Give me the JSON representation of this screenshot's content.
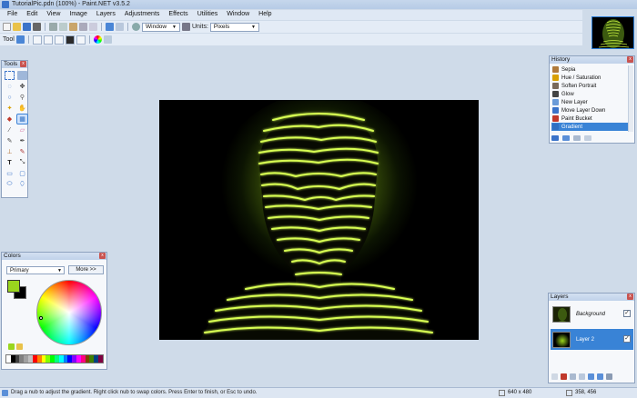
{
  "window": {
    "title": "TutorialPic.pdn (100%) - Paint.NET v3.5.2",
    "minimize": "–",
    "maximize": "□",
    "close": "✕"
  },
  "menu": [
    "File",
    "Edit",
    "View",
    "Image",
    "Layers",
    "Adjustments",
    "Effects",
    "Utilities",
    "Window",
    "Help"
  ],
  "toolbar": {
    "window_label": "Window",
    "units_label": "Units:",
    "units_value": "Pixels",
    "tool_label": "Tool"
  },
  "panels": {
    "tools_title": "Tools",
    "history_title": "History",
    "colors_title": "Colors",
    "layers_title": "Layers",
    "close_glyph": "x"
  },
  "history": {
    "items": [
      {
        "label": "Sepia",
        "color": "#b07a3a"
      },
      {
        "label": "Hue / Saturation",
        "color": "#d9a000"
      },
      {
        "label": "Soften Portrait",
        "color": "#7a6a5a"
      },
      {
        "label": "Glow",
        "color": "#444444"
      },
      {
        "label": "New Layer",
        "color": "#6b9bd8"
      },
      {
        "label": "Move Layer Down",
        "color": "#3a73c9"
      },
      {
        "label": "Paint Bucket",
        "color": "#c0392b"
      },
      {
        "label": "Gradient",
        "color": "#2d6fc2",
        "active": true
      }
    ]
  },
  "colors": {
    "mode": "Primary",
    "more_button": "More >>",
    "primary": "#9ad61e",
    "secondary": "#000000",
    "palette": [
      "#ffffff",
      "#000000",
      "#404040",
      "#808080",
      "#a0a0a0",
      "#c0c0c0",
      "#ff0000",
      "#ff8000",
      "#ffff00",
      "#80ff00",
      "#00ff00",
      "#00ff80",
      "#00ffff",
      "#0080ff",
      "#0000ff",
      "#8000ff",
      "#ff00ff",
      "#ff0080",
      "#804000",
      "#408000",
      "#004080",
      "#800040"
    ]
  },
  "layers": {
    "items": [
      {
        "name": "Background",
        "checked": "✓"
      },
      {
        "name": "Layer 2",
        "checked": "✓",
        "active": true
      }
    ]
  },
  "status": {
    "hint": "Drag a nub to adjust the gradient. Right click nub to swap colors. Press Enter to finish, or Esc to undo.",
    "image_size": "640 x 480",
    "cursor": "358, 456"
  }
}
